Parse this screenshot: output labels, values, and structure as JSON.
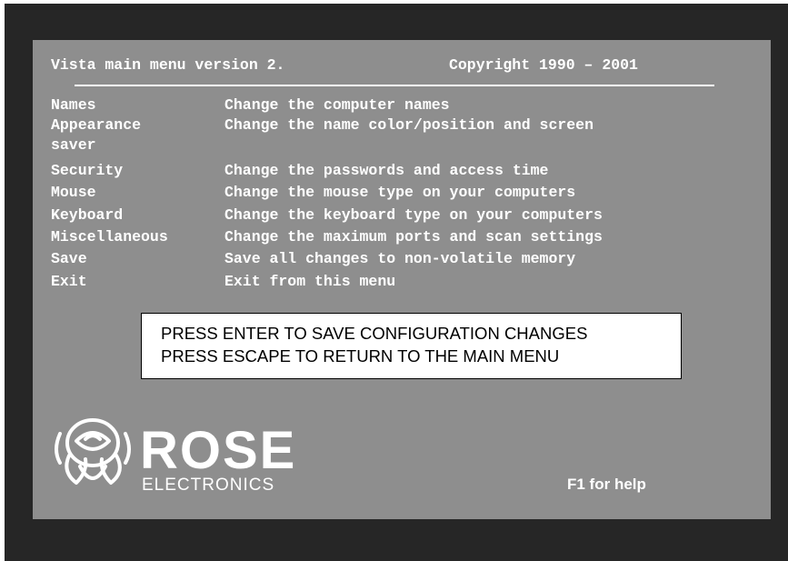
{
  "header": {
    "title": "Vista main menu version 2.",
    "copyright": "Copyright 1990 – 2001"
  },
  "menu": [
    {
      "key": "Names",
      "desc": "Change the computer names"
    },
    {
      "key": "Appearance",
      "desc": "Change the name color/position and screen"
    },
    {
      "key": "saver",
      "desc": ""
    },
    {
      "key": "Security",
      "desc": "Change the passwords and access time"
    },
    {
      "key": "Mouse",
      "desc": "Change the mouse type on your computers"
    },
    {
      "key": "Keyboard",
      "desc": "Change the keyboard type on your computers"
    },
    {
      "key": "Miscellaneous",
      "desc": "Change the maximum ports and scan settings"
    },
    {
      "key": "Save",
      "desc": "Save all changes to non-volatile memory"
    },
    {
      "key": "Exit",
      "desc": "Exit from this menu"
    }
  ],
  "prompt": {
    "line1": "PRESS ENTER TO SAVE CONFIGURATION CHANGES",
    "line2": "PRESS ESCAPE TO RETURN TO THE MAIN MENU"
  },
  "logo": {
    "brand": "ROSE",
    "sub": "ELECTRONICS",
    "icon": "rose-flower-icon"
  },
  "footer": {
    "help": "F1 for help"
  },
  "colors": {
    "screen_bg": "#8e8e8e",
    "frame_bg": "#262626",
    "text": "#ffffff",
    "prompt_bg": "#ffffff"
  }
}
